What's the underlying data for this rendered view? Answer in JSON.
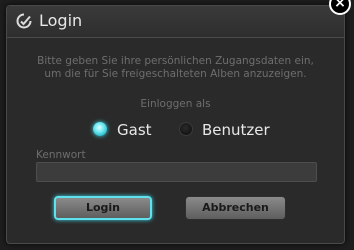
{
  "dialog": {
    "title": "Login",
    "title_icon": "dashboard-check-icon",
    "close_icon": "close-icon",
    "close_glyph": "×"
  },
  "info": {
    "line1": "Bitte geben Sie ihre persönlichen Zugangsdaten ein,",
    "line2": "um die für Sie freigeschalteten Alben anzuzeigen."
  },
  "login_as": {
    "label": "Einloggen als",
    "options": [
      {
        "label": "Gast",
        "selected": true
      },
      {
        "label": "Benutzer",
        "selected": false
      }
    ]
  },
  "password": {
    "label": "Kennwort",
    "value": "",
    "placeholder": ""
  },
  "buttons": {
    "login_label": "Login",
    "cancel_label": "Abbrechen"
  },
  "colors": {
    "accent": "#3fd6e6",
    "background": "#2a2a2a",
    "muted_text": "#6e6e6e"
  }
}
